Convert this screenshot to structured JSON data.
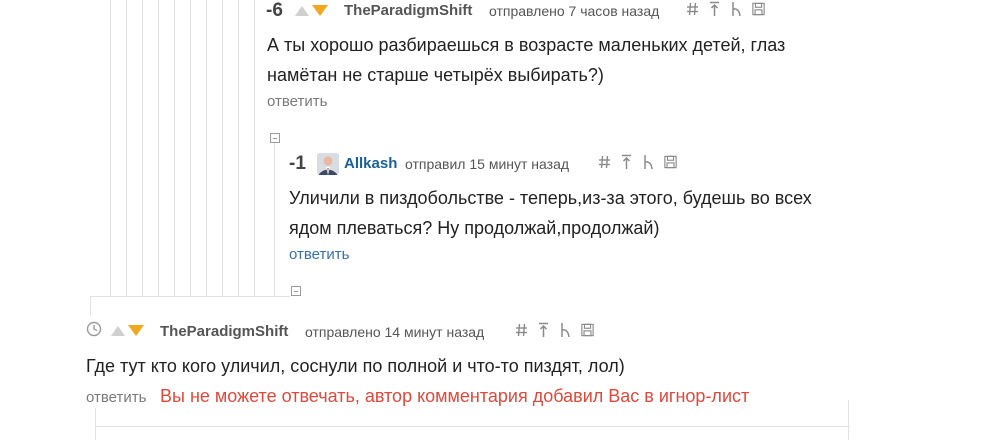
{
  "comment1": {
    "rating": "-6",
    "author": "TheParadigmShift",
    "meta": "отправлено 7 часов назад",
    "text_line1": "А ты хорошо разбираешься в возрасте маленьких детей, глаз",
    "text_line2": "намётан не старше четырёх выбирать?)",
    "reply": "ответить"
  },
  "comment2": {
    "rating": "-1",
    "author": "Allkash",
    "meta": "отправил 15 минут назад",
    "text_line1": "Уличили в пиздобольстве - теперь,из-за этого, будешь во всех",
    "text_line2": "ядом плеваться? Ну продолжай,продолжай)",
    "reply": "ответить"
  },
  "comment3": {
    "author": "TheParadigmShift",
    "meta": "отправлено 14 минут назад",
    "text_line1": "Где тут кто кого уличил, соснули по полной и что-то пиздят, лол)",
    "reply": "ответить",
    "warning": "Вы не можете отвечать, автор комментария добавил Вас в игнор-лист"
  },
  "colors": {
    "author_link": "#1a5f99",
    "reply_link": "#3a6fa8",
    "warning": "#e0483b",
    "vote_down_active": "#f0a81c"
  },
  "icons": [
    "hash-icon",
    "arrow-up-icon",
    "branch-icon",
    "save-icon",
    "clock-icon",
    "collapse-icon",
    "vote-up-icon",
    "vote-down-icon"
  ]
}
